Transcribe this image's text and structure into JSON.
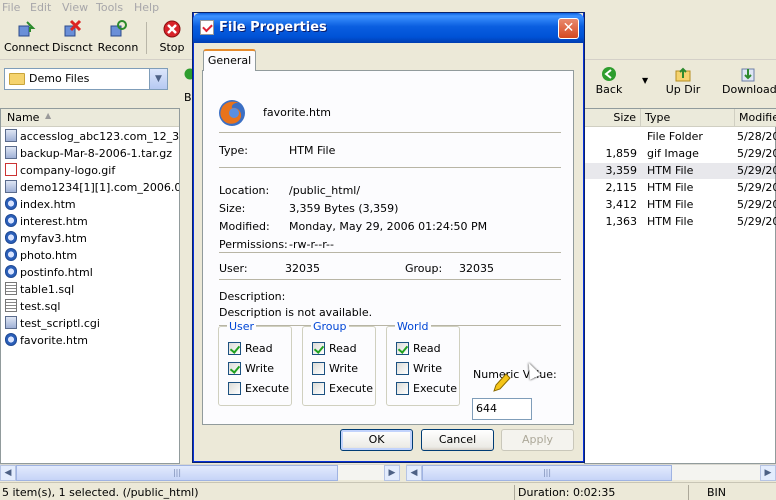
{
  "menubar": {
    "items": [
      "File",
      "Edit",
      "View",
      "Tools",
      "Help"
    ]
  },
  "toolbar": {
    "connect": "Connect",
    "disconnect": "Discnct",
    "reconnect": "Reconn",
    "stop": "Stop"
  },
  "left_pane": {
    "folder": "Demo Files",
    "column_name": "Name",
    "files": [
      {
        "name": "accesslog_abc123.com_12_3...",
        "kind": "arc"
      },
      {
        "name": "backup-Mar-8-2006-1.tar.gz",
        "kind": "arc"
      },
      {
        "name": "company-logo.gif",
        "kind": "gif"
      },
      {
        "name": "demo1234[1][1].com_2006.0...",
        "kind": "arc"
      },
      {
        "name": "index.htm",
        "kind": "htm"
      },
      {
        "name": "interest.htm",
        "kind": "htm"
      },
      {
        "name": "myfav3.htm",
        "kind": "htm"
      },
      {
        "name": "photo.htm",
        "kind": "htm"
      },
      {
        "name": "postinfo.html",
        "kind": "htm"
      },
      {
        "name": "table1.sql",
        "kind": "sql"
      },
      {
        "name": "test.sql",
        "kind": "sql"
      },
      {
        "name": "test_scriptl.cgi",
        "kind": "arc"
      },
      {
        "name": "favorite.htm",
        "kind": "htm"
      }
    ]
  },
  "right_toolbar": {
    "back": "Back",
    "updir": "Up Dir",
    "download": "Download"
  },
  "right_pane": {
    "columns": [
      "Size",
      "Type",
      "Modified"
    ],
    "rows": [
      {
        "size": "",
        "type": "File Folder",
        "modified": "5/28/20"
      },
      {
        "size": "1,859",
        "type": "gif Image",
        "modified": "5/29/20"
      },
      {
        "size": "3,359",
        "type": "HTM File",
        "modified": "5/29/20"
      },
      {
        "size": "2,115",
        "type": "HTM File",
        "modified": "5/29/20"
      },
      {
        "size": "3,412",
        "type": "HTM File",
        "modified": "5/29/20"
      },
      {
        "size": "1,363",
        "type": "HTM File",
        "modified": "5/29/20"
      }
    ]
  },
  "left_b_label": "B",
  "statusbar": {
    "selection": "5 item(s), 1 selected. (/public_html)",
    "duration": "Duration: 0:02:35",
    "mode": "BIN"
  },
  "dialog": {
    "title": "File Properties",
    "tab": "General",
    "filename": "favorite.htm",
    "type_label": "Type:",
    "type_value": "HTM File",
    "location_label": "Location:",
    "location_value": "/public_html/",
    "size_label": "Size:",
    "size_value": "3,359 Bytes (3,359)",
    "modified_label": "Modified:",
    "modified_value": "Monday, May 29, 2006 01:24:50 PM",
    "permissions_label": "Permissions:",
    "permissions_value": "-rw-r--r--",
    "user_label": "User:",
    "user_value": "32035",
    "group_label": "Group:",
    "group_value": "32035",
    "description_label": "Description:",
    "description_value": "Description is not available.",
    "groups": [
      {
        "name": "User",
        "read": true,
        "write": true,
        "execute": false
      },
      {
        "name": "Group",
        "read": true,
        "write": false,
        "execute": false
      },
      {
        "name": "World",
        "read": true,
        "write": false,
        "execute": false
      }
    ],
    "check_labels": {
      "read": "Read",
      "write": "Write",
      "execute": "Execute"
    },
    "numeric_label": "Numeric Value:",
    "numeric_value": "644",
    "ok": "OK",
    "cancel": "Cancel",
    "apply": "Apply"
  }
}
